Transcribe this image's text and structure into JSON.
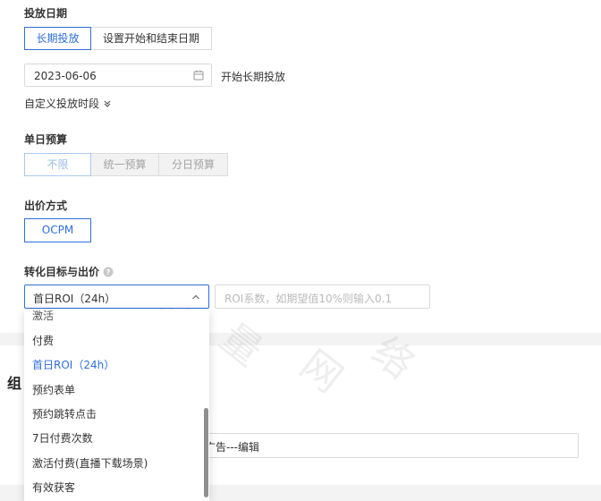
{
  "delivery_date": {
    "label": "投放日期",
    "tabs": [
      "长期投放",
      "设置开始和结束日期"
    ],
    "date_value": "2023-06-06",
    "date_hint": "开始长期投放",
    "custom_period": "自定义投放时段"
  },
  "daily_budget": {
    "label": "单日预算",
    "options": [
      "不限",
      "统一预算",
      "分日预算"
    ]
  },
  "bid_method": {
    "label": "出价方式",
    "option": "OCPM"
  },
  "conversion": {
    "label": "转化目标与出价",
    "selected": "首日ROI（24h）",
    "roi_placeholder": "ROI系数，如期望值10%则输入0.1",
    "options": [
      "激活",
      "付费",
      "首日ROI（24h）",
      "预约表单",
      "预约跳转点击",
      "7日付费次数",
      "激活付费(直播下载场景)",
      "有效获客"
    ]
  },
  "background": {
    "group_prefix": "组",
    "name_value": "广告---编辑"
  },
  "colors": {
    "accent": "#2f6fdc",
    "band": "#f3f3f3"
  }
}
